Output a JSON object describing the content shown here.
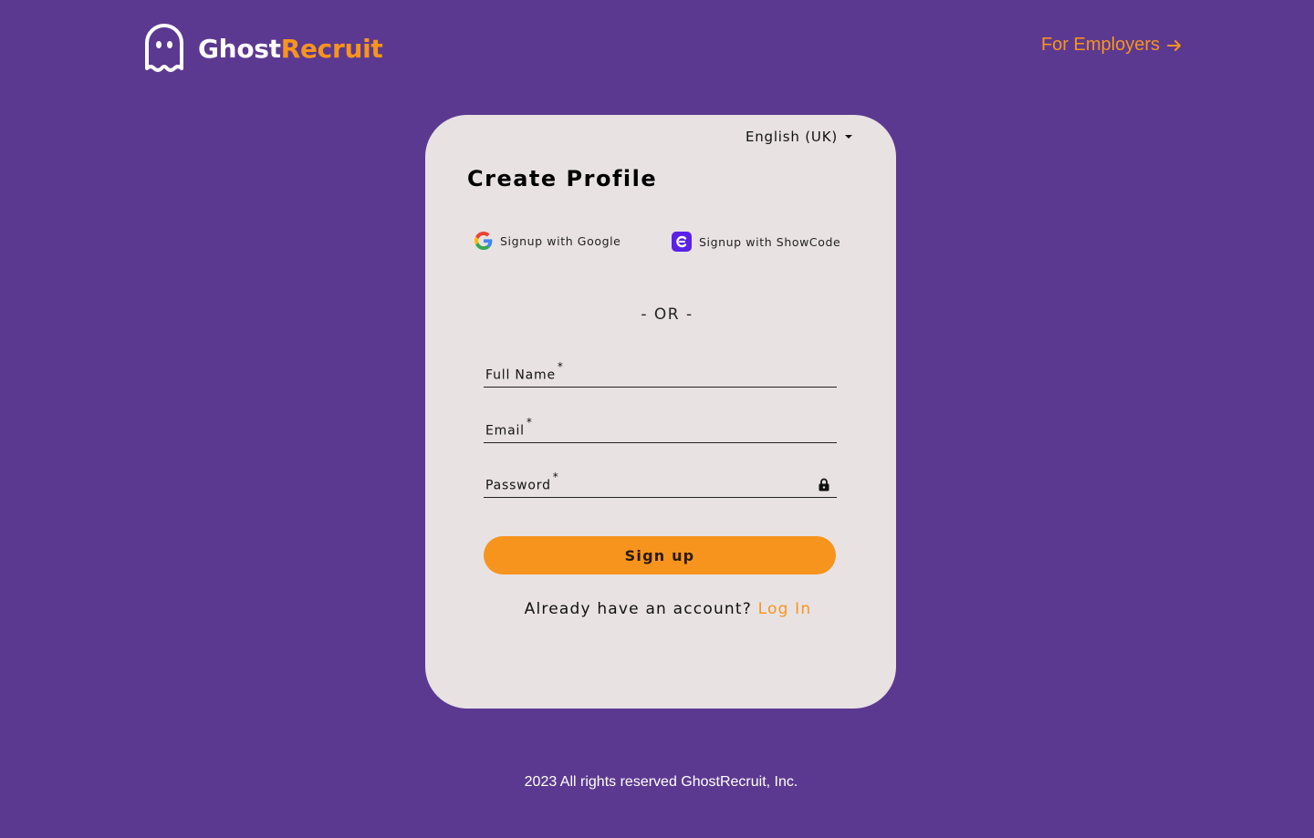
{
  "header": {
    "logo_part1": "Ghost",
    "logo_part2": "Recruit",
    "employers_link": "For Employers"
  },
  "card": {
    "language": "English (UK)",
    "title": "Create Profile",
    "google_label": "Signup with Google",
    "showcode_label": "Signup with ShowCode",
    "or_text": "- OR -",
    "fields": {
      "full_name": "Full Name",
      "email": "Email",
      "password": "Password",
      "required_mark": "*"
    },
    "signup_button": "Sign up",
    "login_prompt": "Already have an account?",
    "login_link": "Log In"
  },
  "footer": {
    "copyright": "2023 All rights reserved GhostRecruit, Inc."
  },
  "icons": [
    "ghost-logo-icon",
    "arrow-right-icon",
    "chevron-down-icon",
    "google-icon",
    "showcode-icon",
    "lock-icon"
  ],
  "colors": {
    "background": "#5c3990",
    "accent": "#f7941d",
    "card": "#e8e2e3",
    "showcode": "#5b21e6"
  }
}
